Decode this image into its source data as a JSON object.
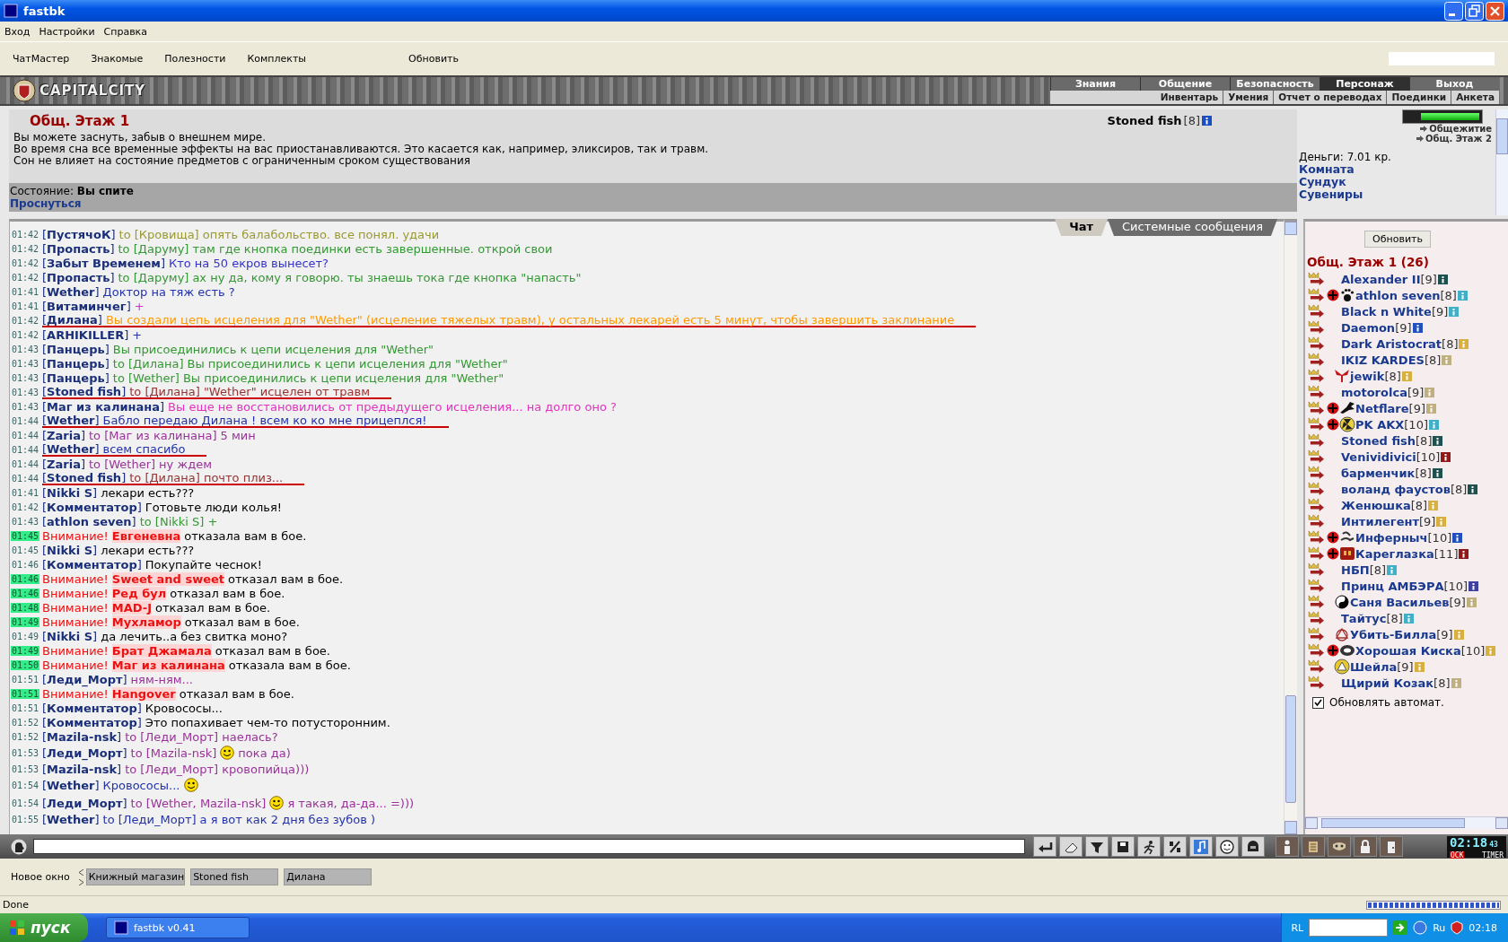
{
  "window": {
    "title": "fastbk"
  },
  "menu": [
    "Вход",
    "Настройки",
    "Справка"
  ],
  "toolbar": [
    "ЧатМастер",
    "Знакомые",
    "Полезности",
    "Комплекты",
    "Обновить"
  ],
  "banner": {
    "logo": "CAPITALCITY",
    "nav": [
      {
        "label": "Знания",
        "selected": false
      },
      {
        "label": "Общение",
        "selected": false
      },
      {
        "label": "Безопасность",
        "selected": false
      },
      {
        "label": "Персонаж",
        "selected": true
      },
      {
        "label": "Выход",
        "selected": false
      }
    ],
    "subnav": [
      "Инвентарь",
      "Умения",
      "Отчет о переводах",
      "Поединки",
      "Анкета"
    ]
  },
  "room": {
    "title": "Общ. Этаж 1",
    "player": {
      "name": "Stoned fish",
      "level": "[8]",
      "color": "#1a4fc4"
    },
    "lines": [
      "Вы можете заснуть, забыв о внешнем мире.",
      "Во время сна все временные эффекты на вас приостанавливаются. Это касается как, например, эликсиров, так и травм.",
      "Сон не влияет на состояние предметов с ограниченным сроком существования"
    ],
    "state_label": "Состояние:",
    "state": "Вы спите",
    "wake_link": "Проснуться"
  },
  "side": {
    "hp": {
      "level": 1
    },
    "exits": [
      "Общежитие",
      "Общ. Этаж 2"
    ],
    "money": "Деньги: 7.01 кр.",
    "links": [
      "Комната",
      "Сундук",
      "Сувениры"
    ]
  },
  "chat_tabs": [
    {
      "label": "Чат",
      "selected": true
    },
    {
      "label": "Системные сообщения",
      "selected": false
    }
  ],
  "messages": [
    {
      "kind": "message",
      "time": "01:42",
      "author": "[**ПустячоК**]",
      "to": "to [Кровища]",
      "text": "опять балабольство. все понял. удачи",
      "color": "#999933",
      "underlined": false
    },
    {
      "kind": "message",
      "time": "01:42",
      "author": "[**Пропасть**]",
      "to": "to [Даруму]",
      "text": "там где кнопка поединки есть завершенные. открой свои",
      "color": "#339933",
      "underlined": false
    },
    {
      "kind": "message",
      "time": "01:42",
      "author": "[**Забыт Временем**]",
      "text": "Кто на 50 екров вынесет?",
      "color": "#3333cc",
      "underlined": false
    },
    {
      "kind": "message",
      "time": "01:42",
      "author": "[**Пропасть**]",
      "to": "to [Даруму]",
      "text": "ах ну да, кому я говорю. ты знаешь тока где кнопка \"напасть\"",
      "color": "#339933",
      "underlined": false
    },
    {
      "kind": "message",
      "time": "01:41",
      "author": "[**Wether**]",
      "text": "Доктор на тяж есть ?",
      "color": "#2233aa",
      "underlined": false
    },
    {
      "kind": "message",
      "time": "01:41",
      "author": "[**Витаминчег**]",
      "text": "+",
      "color": "#cc33cc",
      "underlined": false
    },
    {
      "kind": "message",
      "time": "01:42",
      "author": "[**Дилана**]",
      "text": "Вы создали цепь исцеления для \"Wether\" (исцеление тяжелых травм), у остальных лекарей есть 5 минут, чтобы завершить заклинание",
      "color": "#ff9900",
      "underlined": true
    },
    {
      "kind": "message",
      "time": "01:42",
      "author": "[**ARHIKILLER**]",
      "text": "+",
      "color": "#2233aa",
      "underlined": false
    },
    {
      "kind": "message",
      "time": "01:43",
      "author": "[**Панцерь**]",
      "text": "Вы присоединились к цепи исцеления для \"Wether\"",
      "color": "#339933",
      "underlined": false
    },
    {
      "kind": "message",
      "time": "01:43",
      "author": "[**Панцерь**]",
      "to": "to [Дилана]",
      "text": "Вы присоединились к цепи исцеления для \"Wether\"",
      "color": "#339933",
      "underlined": false
    },
    {
      "kind": "message",
      "time": "01:43",
      "author": "[**Панцерь**]",
      "to": "to [Wether]",
      "text": "Вы присоединились к цепи исцеления для \"Wether\"",
      "color": "#339933",
      "underlined": false
    },
    {
      "kind": "message",
      "time": "01:43",
      "author": "[**Stoned fish**]",
      "to": "to [Дилана]",
      "text": "\"Wether\" исцелен от травм",
      "color": "#993333",
      "underlined": true
    },
    {
      "kind": "message",
      "time": "01:43",
      "author": "[**Маг из калинана**]",
      "text": "Вы еще не восстановились от предыдущего исцеления... на долго оно ?",
      "color": "#e033c0",
      "underlined": false
    },
    {
      "kind": "message",
      "time": "01:44",
      "author": "[**Wether**]",
      "text": "Бабло передаю Дилана ! всем ко ко мне прицеплся!",
      "color": "#2233aa",
      "underlined": true
    },
    {
      "kind": "message",
      "time": "01:44",
      "author": "[**Zaria**]",
      "to": "to [Маг из калинана]",
      "text": "5 мин",
      "color": "#993399",
      "underlined": false
    },
    {
      "kind": "message",
      "time": "01:44",
      "author": "[**Wether**]",
      "text": "всем спасибо",
      "color": "#2233aa",
      "underlined": true
    },
    {
      "kind": "message",
      "time": "01:44",
      "author": "[**Zaria**]",
      "to": "to [Wether]",
      "text": "ну ждем",
      "color": "#993399",
      "underlined": false
    },
    {
      "kind": "message",
      "time": "01:44",
      "author": "[**Stoned fish**]",
      "to": "to [Дилана]",
      "text": "почто плиз...",
      "color": "#993333",
      "underlined": true
    },
    {
      "kind": "message",
      "time": "01:41",
      "author": "[**Nikki S**]",
      "text": "лекари есть???",
      "color": "#000000",
      "underlined": false
    },
    {
      "kind": "message",
      "time": "01:42",
      "author": "[**Комментатор**]",
      "text": "Готовьте люди колья!",
      "color": "#000000",
      "underlined": false
    },
    {
      "kind": "message",
      "time": "01:43",
      "author": "[**athlon seven**]",
      "to": "to [Nikki S]",
      "text": "+",
      "color": "#339933",
      "underlined": false
    },
    {
      "kind": "alert",
      "time": "01:45",
      "label": "Внимание!",
      "name": "Евгеневна",
      "text": "отказала вам в бое."
    },
    {
      "kind": "message",
      "time": "01:45",
      "author": "[**Nikki S**]",
      "text": "лекари есть???",
      "color": "#000000",
      "underlined": false
    },
    {
      "kind": "message",
      "time": "01:46",
      "author": "[**Комментатор**]",
      "text": "Покупайте чеснок!",
      "color": "#000000",
      "underlined": false
    },
    {
      "kind": "alert",
      "time": "01:46",
      "label": "Внимание!",
      "name": "Sweet and sweet",
      "text": "отказал вам в бое."
    },
    {
      "kind": "alert",
      "time": "01:46",
      "label": "Внимание!",
      "name": "Ред бул",
      "text": "отказал вам в бое."
    },
    {
      "kind": "alert",
      "time": "01:48",
      "label": "Внимание!",
      "name": "MAD-J",
      "text": "отказал вам в бое."
    },
    {
      "kind": "alert",
      "time": "01:49",
      "label": "Внимание!",
      "name": "Мухламор",
      "text": "отказал вам в бое."
    },
    {
      "kind": "message",
      "time": "01:49",
      "author": "[**Nikki S**]",
      "text": "да лечить..а без свитка моно?",
      "color": "#000000",
      "underlined": false
    },
    {
      "kind": "alert",
      "time": "01:49",
      "label": "Внимание!",
      "name": "Брат Джамала",
      "text": "отказал вам в бое."
    },
    {
      "kind": "alert",
      "time": "01:50",
      "label": "Внимание!",
      "name": "Маг из калинана",
      "text": "отказала вам в бое."
    },
    {
      "kind": "message",
      "time": "01:51",
      "author": "[**Леди_Морт**]",
      "text": "ням-ням...",
      "color": "#993399",
      "underlined": false
    },
    {
      "kind": "alert",
      "time": "01:51",
      "label": "Внимание!",
      "name": "Hangover",
      "text": "отказал вам в бое."
    },
    {
      "kind": "message",
      "time": "01:51",
      "author": "[**Комментатор**]",
      "text": "Кровососы...",
      "color": "#000000",
      "underlined": false
    },
    {
      "kind": "message",
      "time": "01:52",
      "author": "[**Комментатор**]",
      "text": "Это попахивает чем-то потусторонним.",
      "color": "#000000",
      "underlined": false
    },
    {
      "kind": "message",
      "time": "01:52",
      "author": "[**Mazila-nsk**]",
      "to": "to [Леди_Морт]",
      "text": "наелась?",
      "color": "#993399",
      "underlined": false
    },
    {
      "kind": "message",
      "time": "01:53",
      "author": "[**Леди_Морт**]",
      "to": "to [Mazila-nsk]",
      "text": "пока да)",
      "color": "#993399",
      "underlined": false,
      "smiley_before": true
    },
    {
      "kind": "message",
      "time": "01:53",
      "author": "[**Mazila-nsk**]",
      "to": "to [Леди_Морт]",
      "text": "кровопийца)))",
      "color": "#993399",
      "underlined": false
    },
    {
      "kind": "message",
      "time": "01:54",
      "author": "[**Wether**]",
      "text": "Кровососы...",
      "color": "#2233aa",
      "underlined": false,
      "smiley_after": true
    },
    {
      "kind": "message",
      "time": "01:54",
      "author": "[**Леди_Морт**]",
      "to": "to [Wether, Mazila-nsk]",
      "text": "я такая, да-да... =)))",
      "color": "#993399",
      "underlined": false,
      "smiley_before": true
    },
    {
      "kind": "message",
      "time": "01:55",
      "author": "[**Wether**]",
      "to": "to [Леди_Морт]",
      "text": "а я вот как 2 дня без зубов )",
      "color": "#2233aa",
      "underlined": false
    }
  ],
  "users": {
    "refresh": "Обновить",
    "title": "Общ. Этаж 1 (26)",
    "list": [
      {
        "kind": "plain",
        "name": "Alexander II",
        "level": "[9]",
        "color": "#1e5050",
        "clan": false
      },
      {
        "kind": "paw",
        "name": "athlon seven",
        "level": "[8]",
        "color": "#40b0c8",
        "clan": true
      },
      {
        "kind": "plain",
        "name": "Black n White",
        "level": "[9]",
        "color": "#40b0c8",
        "clan": false
      },
      {
        "kind": "plain",
        "name": "Daemon",
        "level": "[9]",
        "color": "#2050c0",
        "clan": false
      },
      {
        "kind": "plain",
        "name": "Dark Aristocrat",
        "level": "[8]",
        "color": "#d8b040",
        "clan": false
      },
      {
        "kind": "plain",
        "name": "IKIZ KARDES",
        "level": "[8]",
        "color": "#c0b080",
        "clan": false
      },
      {
        "kind": "wings",
        "name": "jewik",
        "level": "[8]",
        "color": "#d8b040",
        "clan": false
      },
      {
        "kind": "plain",
        "name": "motorolca",
        "level": "[9]",
        "color": "#c0b080",
        "clan": false
      },
      {
        "kind": "dragon",
        "name": "Netflare",
        "level": "[9]",
        "color": "#c0b080",
        "clan": true
      },
      {
        "kind": "radiation",
        "name": "PK AKX",
        "level": "[10]",
        "color": "#40b0c8",
        "clan": true
      },
      {
        "kind": "plain",
        "name": "Stoned fish",
        "level": "[8]",
        "color": "#1e5050",
        "clan": false
      },
      {
        "kind": "plain",
        "name": "Venividivici",
        "level": "[10]",
        "color": "#901818",
        "clan": false
      },
      {
        "kind": "plain",
        "name": "барменчик",
        "level": "[8]",
        "color": "#1e5050",
        "clan": false
      },
      {
        "kind": "plain",
        "name": "воланд фаустов",
        "level": "[8]",
        "color": "#1e5050",
        "clan": false
      },
      {
        "kind": "plain",
        "name": "Женюшка",
        "level": "[8]",
        "color": "#d8b040",
        "clan": false
      },
      {
        "kind": "plain",
        "name": "Интилегент",
        "level": "[9]",
        "color": "#d8b040",
        "clan": false
      },
      {
        "kind": "scorpion",
        "name": "Инферныч",
        "level": "[10]",
        "color": "#2050c0",
        "clan": true
      },
      {
        "kind": "mask",
        "name": "Кареглазка",
        "level": "[11]",
        "color": "#901818",
        "clan": true
      },
      {
        "kind": "plain",
        "name": "НБП",
        "level": "[8]",
        "color": "#40b0c8",
        "clan": false
      },
      {
        "kind": "plain",
        "name": "Принц АМБЭРА",
        "level": "[10]",
        "color": "#4040a0",
        "clan": false
      },
      {
        "kind": "yinyang",
        "name": "Саня Васильев",
        "level": "[9]",
        "color": "#c0b080",
        "clan": false
      },
      {
        "kind": "plain",
        "name": "Тайтус",
        "level": "[8]",
        "color": "#40b0c8",
        "clan": false
      },
      {
        "kind": "knot",
        "name": "Убить-Билла",
        "level": "[9]",
        "color": "#d8b040",
        "clan": false
      },
      {
        "kind": "eye",
        "name": "Хорошая Киска",
        "level": "[10]",
        "color": "#d8b040",
        "clan": true
      },
      {
        "kind": "triangle",
        "name": "Шейла",
        "level": "[9]",
        "color": "#d8b040",
        "clan": false
      },
      {
        "kind": "plain",
        "name": "Щирий Козак",
        "level": "[8]",
        "color": "#c0b080",
        "clan": false
      }
    ],
    "auto_refresh": {
      "label": "Обновлять автомат.",
      "checked": true
    }
  },
  "clock": {
    "time": "02:18",
    "seconds": "43",
    "badge": "ОСК",
    "label": "TIMER"
  },
  "windows": {
    "new": "Новое окно",
    "tabs": [
      "Книжный магазин",
      "Stoned fish",
      "Дилана"
    ]
  },
  "status": {
    "text": "Done",
    "level": 1
  },
  "taskbar": {
    "start": "пуск",
    "tasks": [
      "fastbk v0.41"
    ],
    "tray": [
      "RL",
      "Ru"
    ],
    "time": "02:18"
  }
}
